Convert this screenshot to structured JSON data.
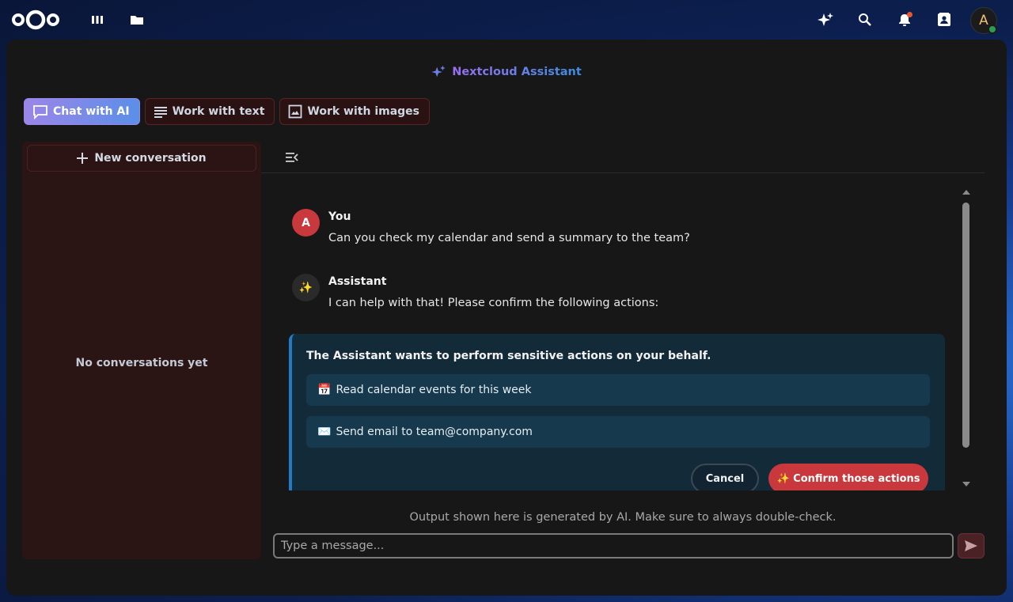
{
  "app": {
    "title": "Nextcloud Assistant"
  },
  "topbar": {
    "apps": [
      "dashboard-icon",
      "files-icon"
    ],
    "right_icons": [
      "assistant-icon",
      "search-icon",
      "notifications-icon",
      "contacts-icon"
    ],
    "avatar_initial": "A"
  },
  "tabs": [
    {
      "label": "Chat with AI",
      "icon": "chat-icon",
      "active": true
    },
    {
      "label": "Work with text",
      "icon": "text-icon",
      "active": false
    },
    {
      "label": "Work with images",
      "icon": "image-icon",
      "active": false
    }
  ],
  "sidebar": {
    "new_conversation_label": "New conversation",
    "empty_label": "No conversations yet"
  },
  "messages": [
    {
      "author": "You",
      "avatar": "A",
      "text": "Can you check my calendar and send a summary to the team?"
    },
    {
      "author": "Assistant",
      "avatar": "✨",
      "text": "I can help with that! Please confirm the following actions:"
    }
  ],
  "confirm": {
    "title": "The Assistant wants to perform sensitive actions on your behalf.",
    "actions": [
      {
        "emoji": "📅",
        "label": "Read calendar events for this week"
      },
      {
        "emoji": "✉️",
        "label": "Send email to team@company.com"
      }
    ],
    "cancel_label": "Cancel",
    "confirm_label": "✨ Confirm those actions"
  },
  "footer": {
    "disclaimer": "Output shown here is generated by AI. Make sure to always double-check.",
    "input_placeholder": "Type a message...",
    "input_value": ""
  },
  "colors": {
    "accent_red": "#c8383c",
    "accent_purple": "#9b86e8",
    "card_border": "#1f7ac8"
  }
}
